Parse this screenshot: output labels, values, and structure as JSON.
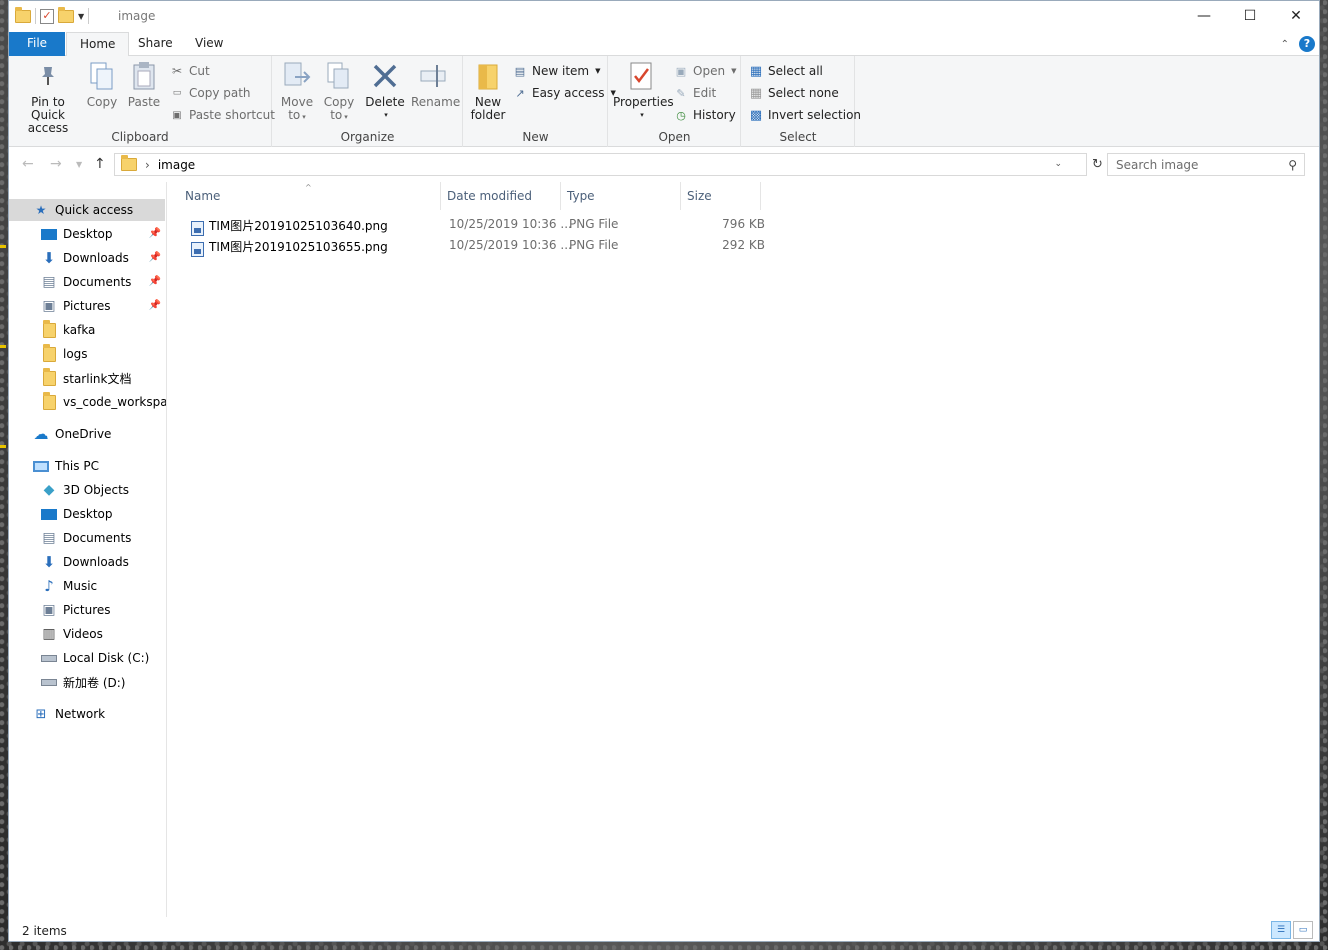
{
  "window": {
    "title": "image",
    "controls": {
      "minimize": "—",
      "maximize": "☐",
      "close": "✕"
    }
  },
  "ribbon_tabs": [
    {
      "label": "File"
    },
    {
      "label": "Home"
    },
    {
      "label": "Share"
    },
    {
      "label": "View"
    }
  ],
  "help_label": "?",
  "clipboard": {
    "pin_label_1": "Pin to Quick",
    "pin_label_2": "access",
    "copy": "Copy",
    "paste": "Paste",
    "cut": "Cut",
    "copy_path": "Copy path",
    "paste_shortcut": "Paste shortcut",
    "group": "Clipboard"
  },
  "organize": {
    "move_to_1": "Move",
    "move_to_2": "to",
    "copy_to_1": "Copy",
    "copy_to_2": "to",
    "delete": "Delete",
    "rename": "Rename",
    "group": "Organize"
  },
  "new": {
    "new_folder_1": "New",
    "new_folder_2": "folder",
    "new_item": "New item",
    "easy_access": "Easy access",
    "group": "New"
  },
  "open": {
    "properties": "Properties",
    "open": "Open",
    "edit": "Edit",
    "history": "History",
    "group": "Open"
  },
  "select": {
    "select_all": "Select all",
    "select_none": "Select none",
    "invert_selection": "Invert selection",
    "group": "Select"
  },
  "address": {
    "path": "image",
    "search_placeholder": "Search image"
  },
  "nav": {
    "quick_access": "Quick access",
    "quick_items": [
      {
        "label": "Desktop",
        "pinned": true
      },
      {
        "label": "Downloads",
        "pinned": true
      },
      {
        "label": "Documents",
        "pinned": true
      },
      {
        "label": "Pictures",
        "pinned": true
      },
      {
        "label": "kafka",
        "pinned": false
      },
      {
        "label": "logs",
        "pinned": false
      },
      {
        "label": "starlink文档",
        "pinned": false
      },
      {
        "label": "vs_code_workspace",
        "pinned": false
      }
    ],
    "onedrive": "OneDrive",
    "this_pc": "This PC",
    "pc_items": [
      {
        "label": "3D Objects"
      },
      {
        "label": "Desktop"
      },
      {
        "label": "Documents"
      },
      {
        "label": "Downloads"
      },
      {
        "label": "Music"
      },
      {
        "label": "Pictures"
      },
      {
        "label": "Videos"
      },
      {
        "label": "Local Disk (C:)"
      },
      {
        "label": "新加卷 (D:)"
      }
    ],
    "network": "Network"
  },
  "columns": {
    "name": "Name",
    "date": "Date modified",
    "type": "Type",
    "size": "Size"
  },
  "files": [
    {
      "name": "TIM图片20191025103640.png",
      "date": "10/25/2019 10:36 ...",
      "type": "PNG File",
      "size": "796 KB"
    },
    {
      "name": "TIM图片20191025103655.png",
      "date": "10/25/2019 10:36 ...",
      "type": "PNG File",
      "size": "292 KB"
    }
  ],
  "status": {
    "item_count": "2 items"
  },
  "colors": {
    "accent": "#1979ca",
    "selection": "#d9d9d9",
    "folder": "#f7d26b"
  }
}
